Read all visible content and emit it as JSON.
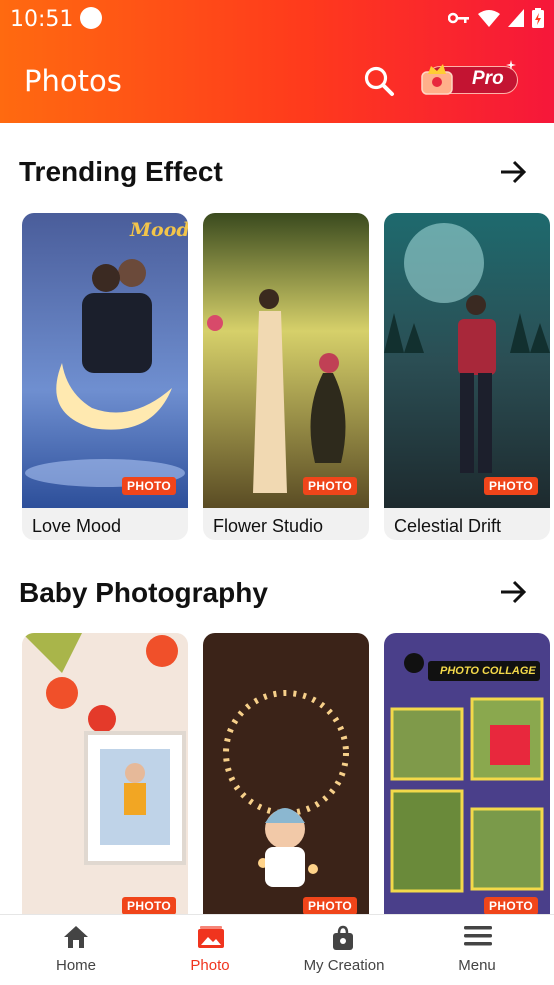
{
  "status_bar": {
    "time": "10:51"
  },
  "header": {
    "title": "Photos",
    "pro_label": "Pro"
  },
  "sections": [
    {
      "title": "Trending Effect",
      "cards": [
        {
          "label": "Love Mood",
          "badge": "PHOTO",
          "overlay": "Mood"
        },
        {
          "label": "Flower Studio",
          "badge": "PHOTO"
        },
        {
          "label": "Celestial Drift",
          "badge": "PHOTO"
        }
      ]
    },
    {
      "title": "Baby Photography",
      "cards": [
        {
          "badge": "PHOTO"
        },
        {
          "badge": "PHOTO"
        },
        {
          "badge": "PHOTO",
          "overlay": "PHOTO COLLAGE"
        }
      ]
    }
  ],
  "bottom_nav": [
    {
      "label": "Home",
      "icon": "home-icon"
    },
    {
      "label": "Photo",
      "icon": "photo-icon",
      "active": true
    },
    {
      "label": "My Creation",
      "icon": "creation-icon"
    },
    {
      "label": "Menu",
      "icon": "menu-icon"
    }
  ],
  "colors": {
    "accent": "#f0341e",
    "header_start": "#ff6a10",
    "header_end": "#f6173a",
    "badge": "#f0451a"
  }
}
